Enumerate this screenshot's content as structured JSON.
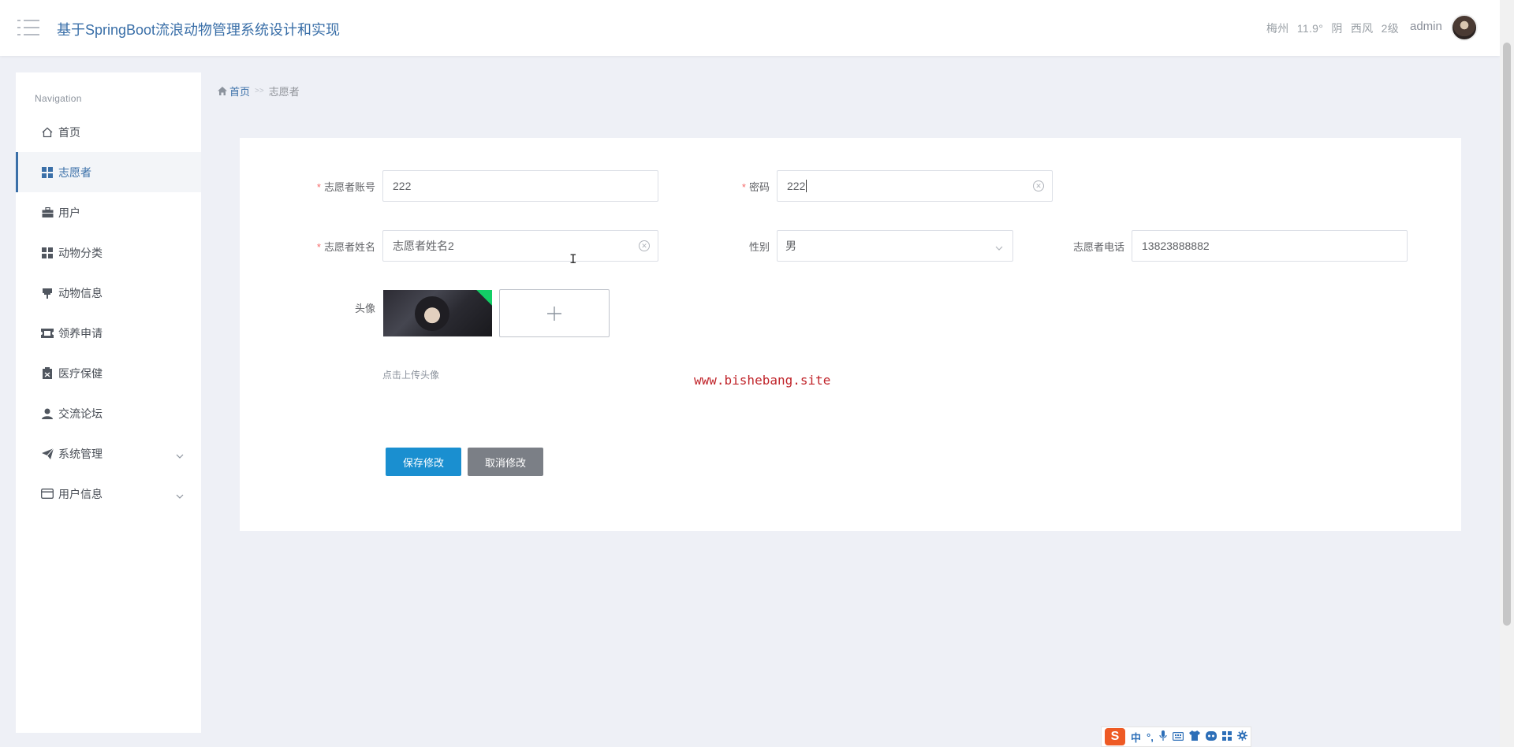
{
  "header": {
    "title": "基于SpringBoot流浪动物管理系统设计和实现",
    "weather": {
      "city": "梅州",
      "temp": "11.9°",
      "condition": "阴",
      "wind": "西风",
      "level": "2级"
    },
    "username": "admin"
  },
  "sidebar": {
    "heading": "Navigation",
    "items": [
      {
        "label": "首页",
        "icon": "home-icon"
      },
      {
        "label": "志愿者",
        "icon": "grid-icon"
      },
      {
        "label": "用户",
        "icon": "briefcase-icon"
      },
      {
        "label": "动物分类",
        "icon": "grid-icon"
      },
      {
        "label": "动物信息",
        "icon": "pin-icon"
      },
      {
        "label": "领养申请",
        "icon": "ticket-icon"
      },
      {
        "label": "医疗保健",
        "icon": "clipboard-icon"
      },
      {
        "label": "交流论坛",
        "icon": "user-icon"
      },
      {
        "label": "系统管理",
        "icon": "send-icon"
      },
      {
        "label": "用户信息",
        "icon": "card-icon"
      }
    ]
  },
  "breadcrumb": {
    "home": "首页",
    "current": "志愿者"
  },
  "form": {
    "account": {
      "label": "志愿者账号",
      "value": "222"
    },
    "password": {
      "label": "密码",
      "value": "222"
    },
    "name": {
      "label": "志愿者姓名",
      "value": "志愿者姓名2"
    },
    "gender": {
      "label": "性别",
      "value": "男"
    },
    "phone": {
      "label": "志愿者电话",
      "value": "13823888882"
    },
    "avatar": {
      "label": "头像",
      "hint": "点击上传头像"
    },
    "save_label": "保存修改",
    "cancel_label": "取消修改"
  },
  "watermark": "www.bishebang.site",
  "ime": {
    "lang": "中",
    "punct": "°,"
  },
  "colors": {
    "accent": "#3a6fa8",
    "primary_button": "#1a8fd0",
    "secondary_button": "#7b7f86",
    "required": "#f56c6c"
  }
}
